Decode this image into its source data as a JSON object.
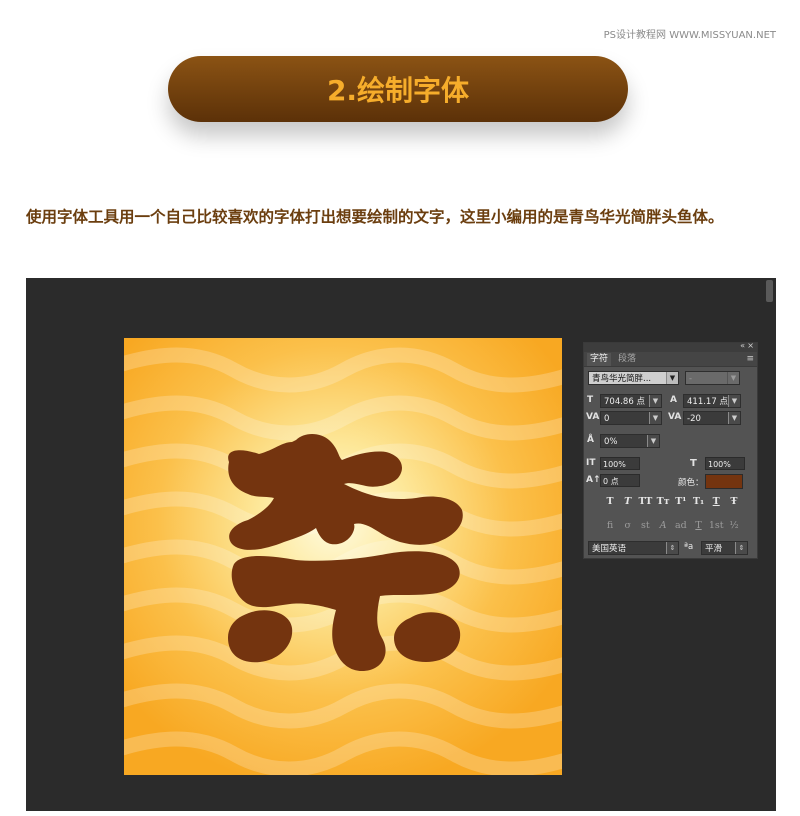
{
  "watermark": "PS设计教程网 WWW.MISSYUAN.NET",
  "header": {
    "title": "2.绘制字体"
  },
  "intro": "使用字体工具用一个自己比较喜欢的字体打出想要绘制的文字，这里小编用的是青鸟华光简胖头鱼体。",
  "colors": {
    "header_bg": "#6b3c0c",
    "header_text": "#f6ad2b",
    "intro_text": "#6b3e0f",
    "glyph": "#74340f",
    "panel_bg": "#535353",
    "workspace_bg": "#2b2b2b"
  },
  "panel": {
    "collapse_icon": "double-chevron-icon",
    "close_icon": "close-icon",
    "menu_icon": "panel-menu-icon",
    "tabs": [
      {
        "label": "字符",
        "active": true
      },
      {
        "label": "段落",
        "active": false
      }
    ],
    "font_family": "青鸟华光简胖...",
    "font_style": "-",
    "font_size": "704.86 点",
    "leading": "411.17 点",
    "kerning": "0",
    "tracking": "-20",
    "tsume": "0%",
    "vertical_scale": "100%",
    "horizontal_scale": "100%",
    "baseline_shift": "0 点",
    "color_label": "颜色：",
    "style_buttons": [
      "T",
      "T",
      "TT",
      "Tт",
      "T¹",
      "T₁",
      "T",
      "Ŧ"
    ],
    "opentype_buttons": [
      "fi",
      "σ",
      "st",
      "A",
      "ad",
      "T",
      "1st",
      "½"
    ],
    "language": "美国英语",
    "aa_label": "ªa",
    "antialias": "平滑"
  }
}
